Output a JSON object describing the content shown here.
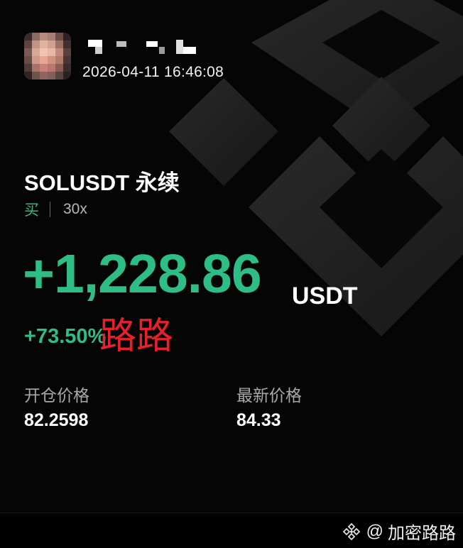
{
  "header": {
    "timestamp": "2026-04-11 16:46:08"
  },
  "position": {
    "pair": "SOLUSDT 永续",
    "side": "买",
    "leverage": "30x",
    "pnl": "+1,228.86",
    "pnl_unit": "USDT",
    "roi": "+73.50%"
  },
  "overlay": {
    "text": "路路"
  },
  "prices": {
    "entry_label": "开仓价格",
    "entry_value": "82.2598",
    "last_label": "最新价格",
    "last_value": "84.33"
  },
  "footer": {
    "at_sign": "@",
    "account": "加密路路",
    "logo_icon": "binance-logo-icon"
  },
  "colors": {
    "profit": "#2ebd85",
    "overlay": "#e8202a",
    "background": "#050505"
  }
}
